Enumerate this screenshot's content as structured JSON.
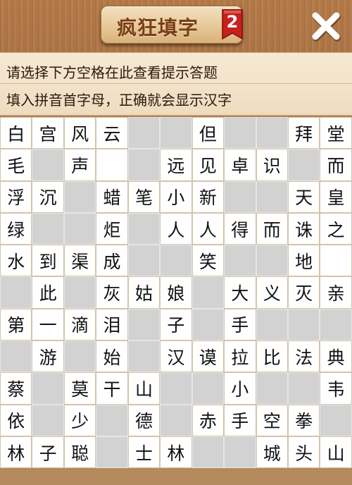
{
  "header": {
    "title": "疯狂填字",
    "level_badge": "2",
    "close_label": "✕"
  },
  "hints": {
    "line1": "请选择下方空格在此查看提示答题",
    "line2": "填入拼音首字母，正确就会显示汉字"
  },
  "grid": {
    "rows": [
      [
        "白",
        "宫",
        "风",
        "云",
        null,
        null,
        "但",
        null,
        null,
        "拜",
        "堂"
      ],
      [
        "毛",
        null,
        "声",
        "",
        null,
        "远",
        "见",
        "卓",
        "识",
        null,
        "而"
      ],
      [
        "浮",
        "沉",
        null,
        "蜡",
        "笔",
        "小",
        "新",
        null,
        null,
        "天",
        "皇"
      ],
      [
        "绿",
        null,
        null,
        "炬",
        null,
        "人",
        "人",
        "得",
        "而",
        "诛",
        "之"
      ],
      [
        "水",
        "到",
        "渠",
        "成",
        null,
        null,
        "笑",
        null,
        null,
        "地",
        ""
      ],
      [
        null,
        "此",
        null,
        "灰",
        "姑",
        "娘",
        null,
        "大",
        "义",
        "灭",
        "亲"
      ],
      [
        "第",
        "一",
        "滴",
        "泪",
        null,
        "子",
        null,
        "手",
        null,
        null,
        null
      ],
      [
        null,
        "游",
        null,
        "始",
        null,
        "汉",
        "谟",
        "拉",
        "比",
        "法",
        "典"
      ],
      [
        "蔡",
        null,
        "莫",
        "干",
        "山",
        null,
        null,
        "小",
        null,
        null,
        "韦"
      ],
      [
        "依",
        null,
        "少",
        null,
        "德",
        null,
        "赤",
        "手",
        "空",
        "拳",
        null
      ],
      [
        "林",
        "子",
        "聪",
        null,
        "士",
        "林",
        null,
        null,
        "城",
        "头",
        "山"
      ]
    ]
  }
}
